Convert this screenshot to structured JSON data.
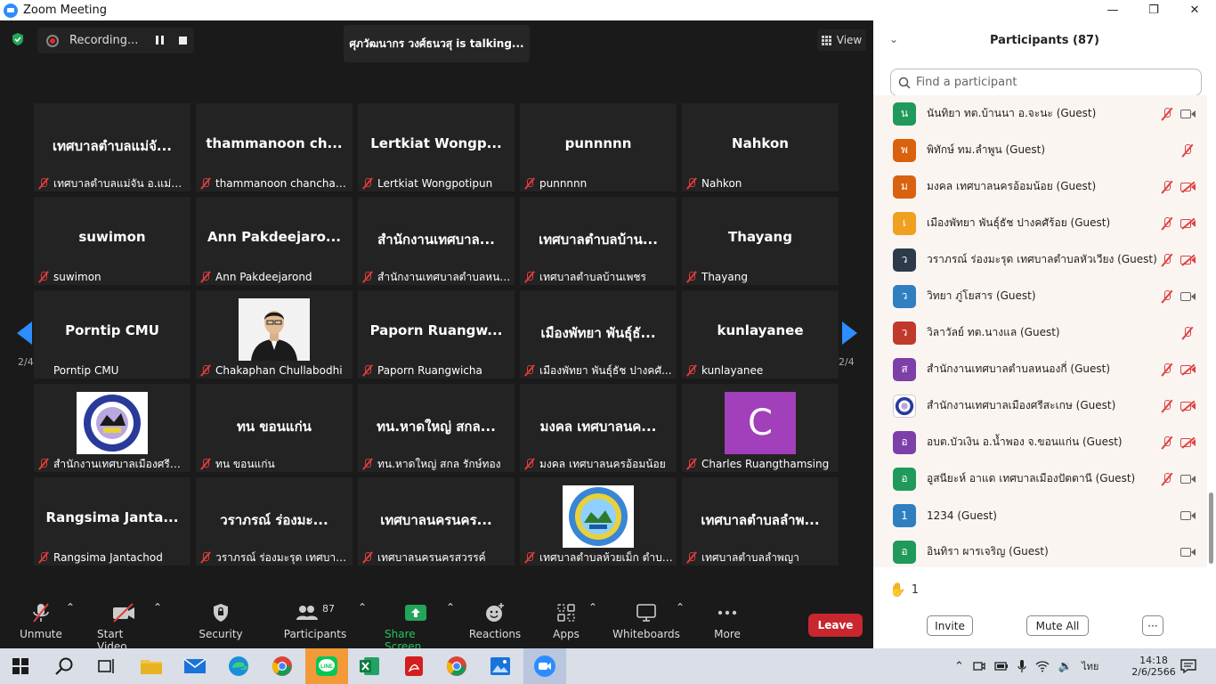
{
  "window": {
    "title": "Zoom Meeting",
    "minimize": "—",
    "maximize": "❐",
    "close": "✕"
  },
  "recording": {
    "label": "Recording..."
  },
  "talking": {
    "text": "ศุภวัฒนากร วงศ์ธนวสุ is talking..."
  },
  "view": {
    "label": "View"
  },
  "pager": {
    "left_page": "2/4",
    "right_page": "2/4"
  },
  "tiles": [
    {
      "big": "เทศบาลตำบลแม่จั...",
      "label": "เทศบาลตำบลแม่จัน อ.แม่จัน ..."
    },
    {
      "big": "thammanoon  ch...",
      "label": "thammanoon chanchaeng"
    },
    {
      "big": "Lertkiat  Wongp...",
      "label": "Lertkiat Wongpotipun"
    },
    {
      "big": "punnnnn",
      "label": "punnnnn"
    },
    {
      "big": "Nahkon",
      "label": "Nahkon"
    },
    {
      "big": "suwimon",
      "label": "suwimon"
    },
    {
      "big": "Ann  Pakdeejaro...",
      "label": "Ann Pakdeejarond"
    },
    {
      "big": "สำนักงานเทศบาล...",
      "label": "สำนักงานเทศบาลตำบลหนห..."
    },
    {
      "big": "เทศบาลตำบลบ้าน...",
      "label": "เทศบาลตำบลบ้านเพชร"
    },
    {
      "big": "Thayang",
      "label": "Thayang"
    },
    {
      "big": "Porntip CMU",
      "label": "Porntip CMU"
    },
    {
      "big": "",
      "label": "Chakaphan Chullabodhi"
    },
    {
      "big": "Paporn  Ruangw...",
      "label": "Paporn Ruangwicha"
    },
    {
      "big": "เมืองพัทยา  พันธุ์ธั...",
      "label": "เมืองพัทยา  พันธุ์ธัช ปางคศั..."
    },
    {
      "big": "kunlayanee",
      "label": "kunlayanee"
    },
    {
      "big": "",
      "label": "สำนักงานเทศบาลเมืองศรีสะเกษ"
    },
    {
      "big": "ทน ขอนแก่น",
      "label": "ทน ขอนแก่น"
    },
    {
      "big": "ทน.หาดใหญ่ สกล...",
      "label": "ทน.หาดใหญ่ สกล รักษ์ทอง"
    },
    {
      "big": "มงคล เทศบาลนค...",
      "label": "มงคล เทศบาลนครอ้อมน้อย"
    },
    {
      "big": "",
      "avatar_letter": "C",
      "label": "Charles Ruangthamsing"
    },
    {
      "big": "Rangsima  Janta...",
      "label": "Rangsima Jantachod"
    },
    {
      "big": "วราภรณ์   ร่องมะ...",
      "label": "วราภรณ์   ร่องมะรุด เทศบาล..."
    },
    {
      "big": "เทศบาลนครนคร...",
      "label": "เทศบาลนครนครสวรรค์"
    },
    {
      "big": "",
      "label": "เทศบาลตำบลห้วยเม็ก ตำบลห้..."
    },
    {
      "big": "เทศบาลตำบลลำพ...",
      "label": "เทศบาลตำบลลำพญา"
    }
  ],
  "toolbar": {
    "unmute": "Unmute",
    "start_video": "Start Video",
    "security": "Security",
    "participants": "Participants",
    "participants_count": "87",
    "share_screen": "Share Screen",
    "reactions": "Reactions",
    "apps": "Apps",
    "whiteboards": "Whiteboards",
    "more": "More",
    "leave": "Leave"
  },
  "panel": {
    "title": "Participants (87)",
    "search_placeholder": "Find a participant",
    "raised_hands": "1",
    "invite": "Invite",
    "mute_all": "Mute All",
    "more": "···",
    "participants": [
      {
        "initial": "น",
        "color": "#1f9a5a",
        "name": "นันทิยา ทต.บ้านนา อ.จะนะ (Guest)",
        "mic": "off",
        "cam": "on"
      },
      {
        "initial": "พ",
        "color": "#d9620f",
        "name": "พิทักษ์ ทม.ลำพูน (Guest)",
        "mic": "off",
        "cam": "none"
      },
      {
        "initial": "ม",
        "color": "#d9620f",
        "name": "มงคล เทศบาลนครอ้อมน้อย (Guest)",
        "mic": "off",
        "cam": "off"
      },
      {
        "initial": "เ",
        "color": "#f0a020",
        "name": "เมืองพัทยา  พันธุ์ธัช ปางคศัร้อย (Guest)",
        "mic": "off",
        "cam": "off"
      },
      {
        "initial": "ว",
        "color": "#2c3a4a",
        "name": "วราภรณ์   ร่องมะรุด เทศบาลตำบลหัวเวียง (Guest)",
        "mic": "off",
        "cam": "off"
      },
      {
        "initial": "ว",
        "color": "#2f7fc1",
        "name": "วิทยา ภู่โยสาร (Guest)",
        "mic": "off",
        "cam": "on"
      },
      {
        "initial": "ว",
        "color": "#c0392b",
        "name": "วิลาวัลย์ ทต.นางแล (Guest)",
        "mic": "off",
        "cam": "none"
      },
      {
        "initial": "ส",
        "color": "#7d3fa8",
        "name": "สำนักงานเทศบาลตำบลหนองกี่ (Guest)",
        "mic": "off",
        "cam": "off"
      },
      {
        "initial": "",
        "color": "#ffffff",
        "name": "สำนักงานเทศบาลเมืองศรีสะเกษ (Guest)",
        "mic": "off",
        "cam": "off"
      },
      {
        "initial": "อ",
        "color": "#7d3fa8",
        "name": "อบต.บัวเงิน อ.น้ำพอง จ.ขอนแก่น (Guest)",
        "mic": "off",
        "cam": "off"
      },
      {
        "initial": "อ",
        "color": "#1f9a5a",
        "name": "อูสนียะห์ อาแด เทศบาลเมืองปัตตานี (Guest)",
        "mic": "off",
        "cam": "on"
      },
      {
        "initial": "1",
        "color": "#2f7fc1",
        "name": "1234 (Guest)",
        "mic": "none",
        "cam": "on"
      },
      {
        "initial": "อ",
        "color": "#1f9a5a",
        "name": "อินทิรา ผารเจริญ (Guest)",
        "mic": "none",
        "cam": "on"
      }
    ]
  },
  "taskbar": {
    "language": "ไทย",
    "time": "14:18",
    "date": "2/6/2566"
  }
}
